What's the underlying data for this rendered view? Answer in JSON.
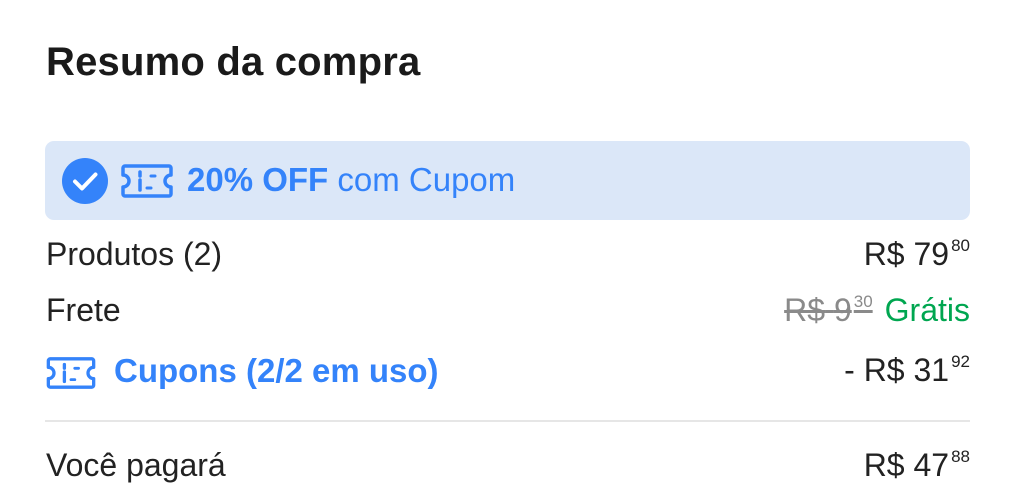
{
  "summary": {
    "title": "Resumo da compra"
  },
  "coupon_banner": {
    "highlight": "20% OFF",
    "text": " com Cupom",
    "accent_color": "#3483fa",
    "background_color": "#dbe7f8"
  },
  "rows": {
    "products": {
      "label": "Produtos (2)",
      "currency": "R$",
      "amount": "79",
      "cents": "80"
    },
    "shipping": {
      "label": "Frete",
      "old_currency": "R$",
      "old_amount": "9",
      "old_cents": "30",
      "free_label": "Grátis"
    },
    "coupons": {
      "label": "Cupons (2/2 em uso)",
      "prefix": "- R$",
      "amount": "31",
      "cents": "92"
    },
    "total": {
      "label": "Você pagará",
      "currency": "R$",
      "amount": "47",
      "cents": "88"
    }
  },
  "icons": {
    "check": "check-circle-icon",
    "ticket": "ticket-icon"
  },
  "colors": {
    "success_green": "#00a650",
    "link_blue": "#3483fa"
  }
}
